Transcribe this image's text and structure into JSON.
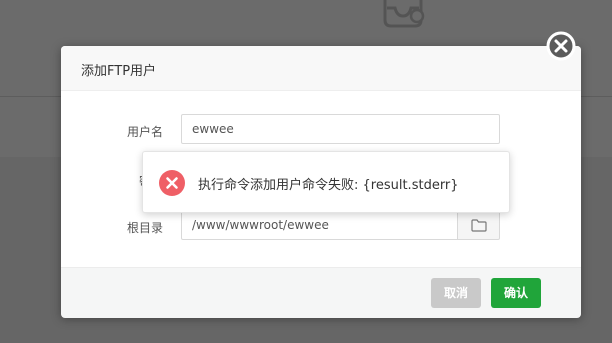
{
  "dialog": {
    "title": "添加FTP用户",
    "fields": {
      "username": {
        "label": "用户名",
        "value": "ewwee"
      },
      "password": {
        "label": "密码"
      },
      "root_dir": {
        "label": "根目录",
        "value": "/www/wwwroot/ewwee"
      }
    },
    "buttons": {
      "cancel": "取消",
      "confirm": "确认"
    }
  },
  "toast": {
    "message": "执行命令添加用户命令失败: {result.stderr}"
  },
  "colors": {
    "accent_green": "#20a53a",
    "error_red": "#ef5f66",
    "cancel_gray": "#c9c9c9",
    "overlay": "#6b6b6b"
  },
  "icons": {
    "close": "close-circle-icon",
    "folder": "folder-icon",
    "error": "error-circle-icon",
    "background": "inbox-icon"
  }
}
